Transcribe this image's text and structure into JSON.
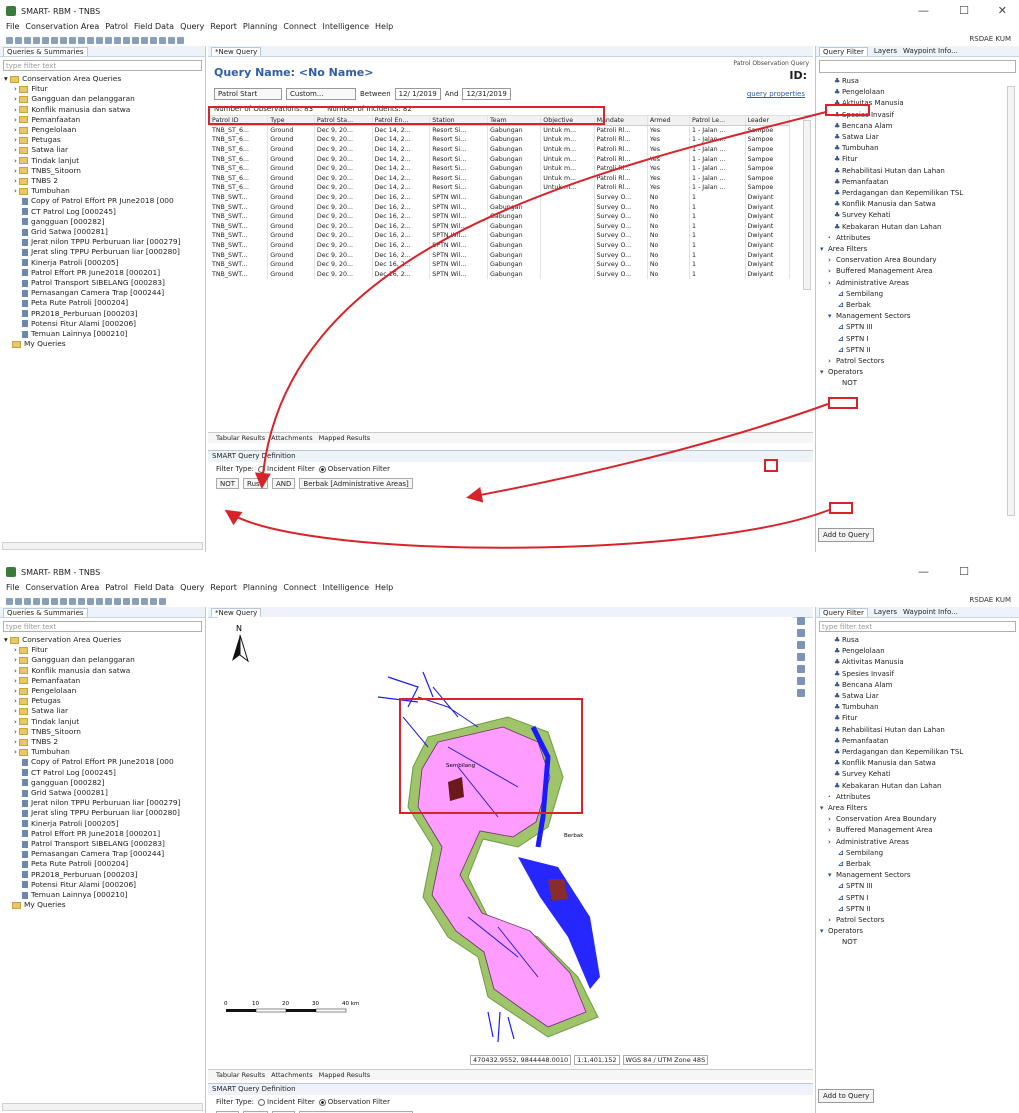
{
  "window": {
    "title": "SMART- RBM - TNBS",
    "minimize": "—",
    "maximize": "☐",
    "close": "✕"
  },
  "menu": [
    "File",
    "Conservation Area",
    "Patrol",
    "Field Data",
    "Query",
    "Report",
    "Planning",
    "Connect",
    "Intelligence",
    "Help"
  ],
  "perspective": "RSDAE KUM",
  "left_tab": "Queries & Summaries",
  "center_tab": "*New Query",
  "filter_placeholder": "type filter text",
  "queries": {
    "root": "Conservation Area Queries",
    "folders": [
      "Fitur",
      "Gangguan dan pelanggaran",
      "Konflik manusia dan satwa",
      "Pemanfaatan",
      "Pengelolaan",
      "Petugas",
      "Satwa liar",
      "Tindak lanjut",
      "TNBS_Sitoorn",
      "TNBS 2",
      "Tumbuhan"
    ],
    "items": [
      "Copy of Patrol Effort PR June2018 [000",
      "CT Patrol Log [000245]",
      "gangguan [000282]",
      "Grid Satwa [000281]",
      "Jerat nilon TPPU Perburuan liar [000279]",
      "Jerat sling TPPU Perburuan liar [000280]",
      "Kinerja Patroli [000205]",
      "Patrol Effort PR June2018 [000201]",
      "Patrol Transport SIBELANG [000283]",
      "Pemasangan Camera Trap [000244]",
      "Peta Rute Patroli [000204]",
      "PR2018_Perburuan [000203]",
      "Potensi Fitur Alami [000206]",
      "Temuan Lainnya [000210]"
    ],
    "my_queries": "My Queries"
  },
  "query": {
    "name_label": "Query Name:",
    "name_value": "<No Name>",
    "type_label": "Patrol Observation Query",
    "id_label": "ID:",
    "date_filter": "Patrol Start",
    "range": "Custom...",
    "between_label": "Between",
    "start_date": "12/ 1/2019",
    "and_label": "And",
    "end_date": "12/31/2019",
    "props_link": "query properties",
    "observations": "Number of Observations: 83",
    "incidents": "Number of Incidents: 82"
  },
  "table": {
    "columns": [
      "Patrol ID",
      "Type",
      "Patrol Sta...",
      "Patrol En...",
      "Station",
      "Team",
      "Objective",
      "Mandate",
      "Armed",
      "Patrol Le...",
      "Leader"
    ],
    "rows": [
      [
        "TNB_ST_6...",
        "Ground",
        "Dec 9, 20...",
        "Dec 14, 2...",
        "Resort Si...",
        "Gabungan",
        "Untuk m...",
        "Patroli Rl...",
        "Yes",
        "1 - Jalan ...",
        "Sampoe"
      ],
      [
        "TNB_ST_6...",
        "Ground",
        "Dec 9, 20...",
        "Dec 14, 2...",
        "Resort Si...",
        "Gabungan",
        "Untuk m...",
        "Patroli Rl...",
        "Yes",
        "1 - Jalan ...",
        "Sampoe"
      ],
      [
        "TNB_ST_6...",
        "Ground",
        "Dec 9, 20...",
        "Dec 14, 2...",
        "Resort Si...",
        "Gabungan",
        "Untuk m...",
        "Patroli Rl...",
        "Yes",
        "1 - Jalan ...",
        "Sampoe"
      ],
      [
        "TNB_ST_6...",
        "Ground",
        "Dec 9, 20...",
        "Dec 14, 2...",
        "Resort Si...",
        "Gabungan",
        "Untuk m...",
        "Patroli Rl...",
        "Yes",
        "1 - Jalan ...",
        "Sampoe"
      ],
      [
        "TNB_ST_6...",
        "Ground",
        "Dec 9, 20...",
        "Dec 14, 2...",
        "Resort Si...",
        "Gabungan",
        "Untuk m...",
        "Patroli Rl...",
        "Yes",
        "1 - Jalan ...",
        "Sampoe"
      ],
      [
        "TNB_ST_6...",
        "Ground",
        "Dec 9, 20...",
        "Dec 14, 2...",
        "Resort Si...",
        "Gabungan",
        "Untuk m...",
        "Patroli Rl...",
        "Yes",
        "1 - Jalan ...",
        "Sampoe"
      ],
      [
        "TNB_ST_6...",
        "Ground",
        "Dec 9, 20...",
        "Dec 14, 2...",
        "Resort Si...",
        "Gabungan",
        "Untuk m...",
        "Patroli Rl...",
        "Yes",
        "1 - Jalan ...",
        "Sampoe"
      ],
      [
        "TNB_SWT...",
        "Ground",
        "Dec 9, 20...",
        "Dec 16, 2...",
        "SPTN Wil...",
        "Gabungan",
        "",
        "Survey O...",
        "No",
        "1",
        "Dwiyant"
      ],
      [
        "TNB_SWT...",
        "Ground",
        "Dec 9, 20...",
        "Dec 16, 2...",
        "SPTN Wil...",
        "Gabungan",
        "",
        "Survey O...",
        "No",
        "1",
        "Dwiyant"
      ],
      [
        "TNB_SWT...",
        "Ground",
        "Dec 9, 20...",
        "Dec 16, 2...",
        "SPTN Wil...",
        "Gabungan",
        "",
        "Survey O...",
        "No",
        "1",
        "Dwiyant"
      ],
      [
        "TNB_SWT...",
        "Ground",
        "Dec 9, 20...",
        "Dec 16, 2...",
        "SPTN Wil...",
        "Gabungan",
        "",
        "Survey O...",
        "No",
        "1",
        "Dwiyant"
      ],
      [
        "TNB_SWT...",
        "Ground",
        "Dec 9, 20...",
        "Dec 16, 2...",
        "SPTN Wil...",
        "Gabungan",
        "",
        "Survey O...",
        "No",
        "1",
        "Dwiyant"
      ],
      [
        "TNB_SWT...",
        "Ground",
        "Dec 9, 20...",
        "Dec 16, 2...",
        "SPTN Wil...",
        "Gabungan",
        "",
        "Survey O...",
        "No",
        "1",
        "Dwiyant"
      ],
      [
        "TNB_SWT...",
        "Ground",
        "Dec 9, 20...",
        "Dec 16, 2...",
        "SPTN Wil...",
        "Gabungan",
        "",
        "Survey O...",
        "No",
        "1",
        "Dwiyant"
      ],
      [
        "TNB_SWT...",
        "Ground",
        "Dec 9, 20...",
        "Dec 16, 2...",
        "SPTN Wil...",
        "Gabungan",
        "",
        "Survey O...",
        "No",
        "1",
        "Dwiyant"
      ],
      [
        "TNB_SWT...",
        "Ground",
        "Dec 9, 20...",
        "Dec 16, 2...",
        "SPTN Wil...",
        "Gabungan",
        "",
        "Survey O...",
        "No",
        "1",
        "Dwiyant"
      ]
    ]
  },
  "result_tabs": [
    "Tabular Results",
    "Attachments",
    "Mapped Results"
  ],
  "definition": {
    "title": "SMART Query Definition",
    "filter_type_label": "Filter Type:",
    "incident_filter": "Incident Filter",
    "observation_filter": "Observation Filter",
    "not": "NOT",
    "term": "Rusa",
    "op": "AND",
    "area": "Berbak [Administrative Areas]"
  },
  "right_tabs": [
    "Query Filter",
    "Layers",
    "Waypoint Info..."
  ],
  "right_tree": {
    "categories": [
      "Rusa",
      "Pengelolaan",
      "Aktivitas Manusia",
      "Spesies Invasif",
      "Bencana Alam",
      "Satwa Liar",
      "Tumbuhan",
      "Fitur",
      "Rehabilitasi Hutan dan Lahan",
      "Pemanfaatan",
      "Perdagangan dan Kepemilikan TSL",
      "Konflik Manusia dan Satwa",
      "Survey Kehati",
      "Kebakaran Hutan dan Lahan"
    ],
    "attributes": "Attributes",
    "area_filters": "Area Filters",
    "area_items": [
      "Conservation Area Boundary",
      "Buffered Management Area",
      "Administrative Areas"
    ],
    "admin_items": [
      "Sembilang",
      "Berbak"
    ],
    "mgmt": "Management Sectors",
    "mgmt_items": [
      "SPTN III",
      "SPTN I",
      "SPTN II"
    ],
    "patrol_sectors": "Patrol Sectors",
    "operators": "Operators",
    "op_not": "NOT",
    "add_button": "Add to Query"
  },
  "map": {
    "north": "N",
    "scale_labels": [
      "0",
      "10",
      "20",
      "30",
      "40 km"
    ],
    "place_labels": [
      "Sembilang",
      "Berbak"
    ],
    "coords": "470432.9552, 9844448.0010",
    "scale": "1:1,401,152",
    "crs": "WGS 84 / UTM Zone 48S"
  }
}
